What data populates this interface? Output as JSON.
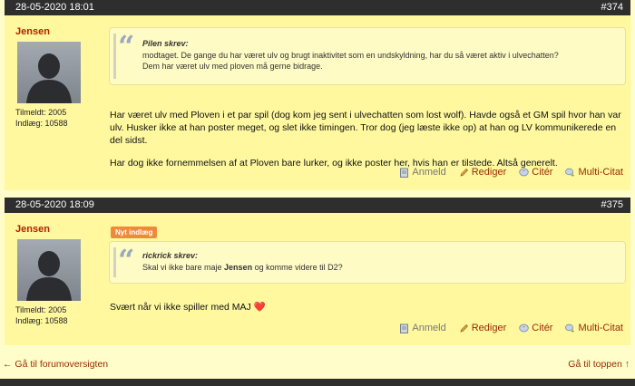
{
  "posts": [
    {
      "date": "28-05-2020 18:01",
      "number": "#374",
      "author": "Jensen",
      "joined": "Tilmeldt: 2005",
      "count": "Indlæg: 10588",
      "quote_author": "Pilen skrev:",
      "quote_line1": "modtaget. De gange du har været ulv og brugt inaktivitet som en undskyldning, har du så været aktiv i ulvechatten?",
      "quote_line2": "Dem har været ulv med ploven må gerne bidrage.",
      "para1": " Har været ulv med Ploven i et par spil (dog kom jeg sent i ulvechatten som lost wolf). Havde også et GM spil hvor han var ulv. Husker ikke at han poster meget, og slet ikke timingen. Tror dog (jeg læste ikke op) at han og LV kommunikerede en del sidst.",
      "para2": "Har dog ikke fornemmelsen af at Ploven bare lurker, og ikke poster her, hvis han er tilstede. Altså generelt."
    },
    {
      "date": "28-05-2020 18:09",
      "number": "#375",
      "badge": "Nyt indlæg",
      "author": "Jensen",
      "joined": "Tilmeldt: 2005",
      "count": "Indlæg: 10588",
      "quote_author": "rickrick skrev:",
      "quote_pre": "Skal vi ikke bare maje ",
      "quote_bold": "Jensen",
      "quote_post": " og komme videre til D2?",
      "reply": "Svært når vi ikke spiller med MAJ ",
      "heart": "❤️"
    }
  ],
  "actions": {
    "report": "Anmeld",
    "edit": "Rediger",
    "quote": "Citér",
    "multiquote": "Multi-Citat"
  },
  "nav": {
    "back": "← Gå til forumoversigten",
    "top": "Gå til toppen ↑"
  },
  "colors": {
    "page_bg": "#fffeca",
    "post_bg": "#fff89e",
    "header_bg": "#2e2e2e",
    "author": "#b22200",
    "link": "#9b2a00",
    "badge": "#f0893a"
  }
}
